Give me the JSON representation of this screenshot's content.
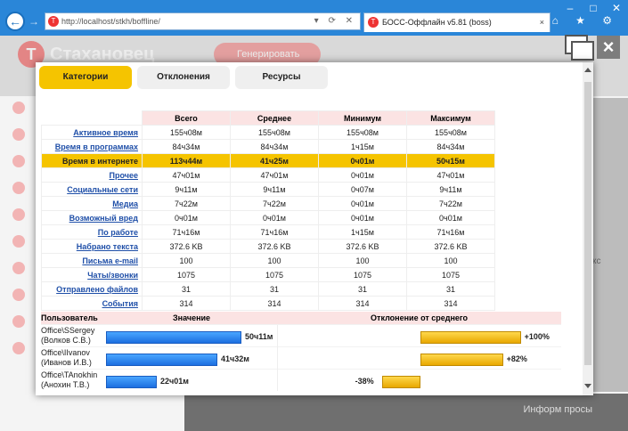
{
  "browser": {
    "url": "http://localhost/stkh/boffline/",
    "tab_title": "БОСС-Оффлайн v5.81 (boss)",
    "tab_close": "×",
    "favicon_letter": "Т",
    "window_controls": [
      "–",
      "□",
      "✕"
    ],
    "toolbar_icons": "⌂ ★ ⚙",
    "address_tools": "▾ ⟳ ✕"
  },
  "background": {
    "brand_name": "Стахановец",
    "pill_label": "Генерировать",
    "bottom_text": "Информ  просы"
  },
  "tabs": [
    "Категории",
    "Отклонения",
    "Ресурсы"
  ],
  "active_tab": 0,
  "stats": {
    "columns": [
      "Всего",
      "Среднее",
      "Минимум",
      "Максимум"
    ],
    "rows": [
      {
        "label": "Активное время",
        "values": [
          "155ч08м",
          "155ч08м",
          "155ч08м",
          "155ч08м"
        ]
      },
      {
        "label": "Время в программах",
        "values": [
          "84ч34м",
          "84ч34м",
          "1ч15м",
          "84ч34м"
        ]
      },
      {
        "label": "Время в интернете",
        "values": [
          "113ч44м",
          "41ч25м",
          "0ч01м",
          "50ч15м"
        ],
        "highlight": true
      },
      {
        "label": "Прочее",
        "values": [
          "47ч01м",
          "47ч01м",
          "0ч01м",
          "47ч01м"
        ]
      },
      {
        "label": "Социальные сети",
        "values": [
          "9ч11м",
          "9ч11м",
          "0ч07м",
          "9ч11м"
        ]
      },
      {
        "label": "Медиа",
        "values": [
          "7ч22м",
          "7ч22м",
          "0ч01м",
          "7ч22м"
        ]
      },
      {
        "label": "Возможный вред",
        "values": [
          "0ч01м",
          "0ч01м",
          "0ч01м",
          "0ч01м"
        ]
      },
      {
        "label": "По работе",
        "values": [
          "71ч16м",
          "71ч16м",
          "1ч15м",
          "71ч16м"
        ]
      },
      {
        "label": "Набрано текста",
        "values": [
          "372.6 KB",
          "372.6 KB",
          "372.6 KB",
          "372.6 KB"
        ]
      },
      {
        "label": "Письма e-mail",
        "values": [
          "100",
          "100",
          "100",
          "100"
        ]
      },
      {
        "label": "Чаты/звонки",
        "values": [
          "1075",
          "1075",
          "1075",
          "1075"
        ]
      },
      {
        "label": "Отправлено файлов",
        "values": [
          "31",
          "31",
          "31",
          "31"
        ]
      },
      {
        "label": "События",
        "values": [
          "314",
          "314",
          "314",
          "314"
        ]
      }
    ]
  },
  "users": {
    "headers": [
      "Пользователь",
      "Значение",
      "Отклонение от среднего"
    ],
    "rows": [
      {
        "login": "Office\\SSergey",
        "name": "(Волков С.В.)",
        "value": "50ч11м",
        "value_fraction": 0.8,
        "deviation": "+100%",
        "deviation_pct": 100
      },
      {
        "login": "Office\\IIvanov",
        "name": "(Иванов И.В.)",
        "value": "41ч32м",
        "value_fraction": 0.66,
        "deviation": "+82%",
        "deviation_pct": 82
      },
      {
        "login": "Office\\TAnokhin",
        "name": "(Анохин Т.В.)",
        "value": "22ч01м",
        "value_fraction": 0.3,
        "deviation": "-38%",
        "deviation_pct": -38
      }
    ]
  }
}
